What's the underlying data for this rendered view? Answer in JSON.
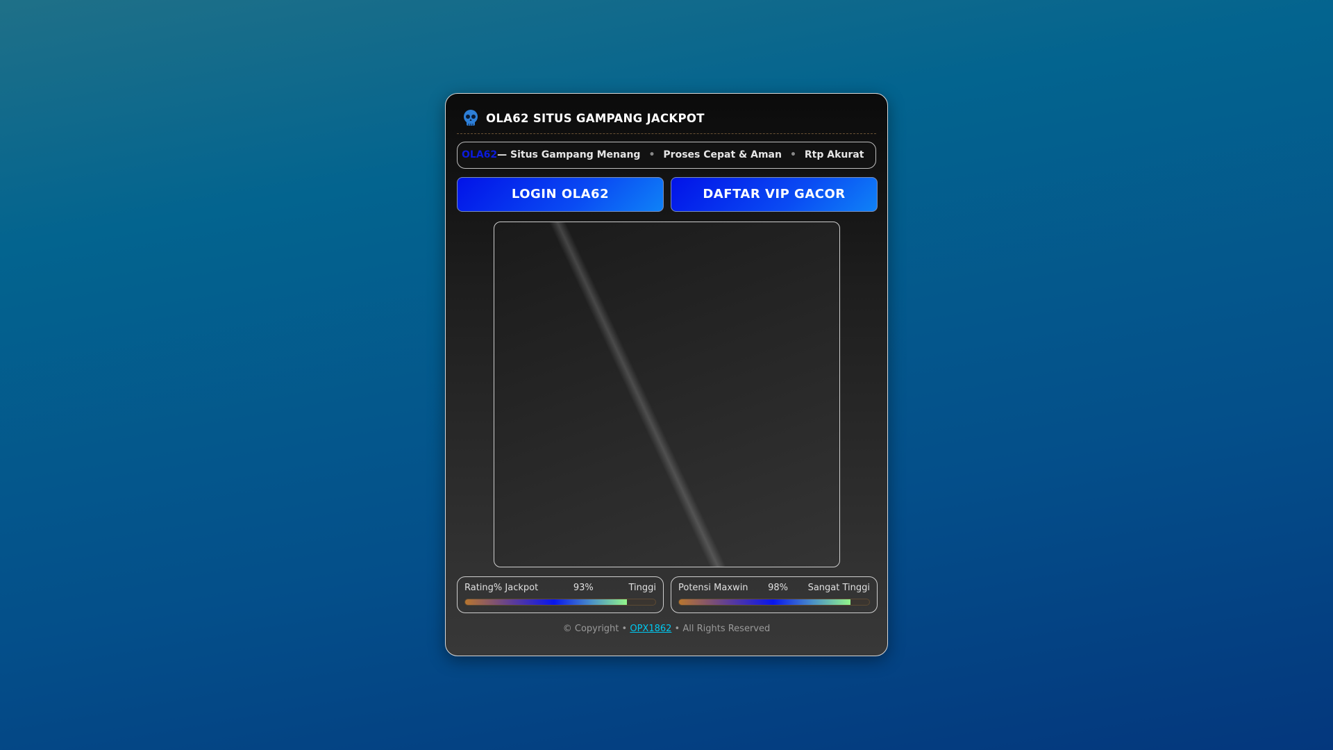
{
  "header": {
    "title": "OLA62 SITUS GAMPANG JACKPOT",
    "icon": "skull-icon"
  },
  "marquee": {
    "brand": "OLA62",
    "items": [
      "— Situs Gampang Menang",
      "Proses Cepat & Aman",
      "Rtp Akurat"
    ],
    "separator": "•"
  },
  "buttons": {
    "login": "LOGIN OLA62",
    "register": "DAFTAR VIP GACOR"
  },
  "stats": [
    {
      "label": "Rating% Jackpot",
      "value": "93%",
      "level": "Tinggi",
      "fill": 0.85
    },
    {
      "label": "Potensi Maxwin",
      "value": "98%",
      "level": "Sangat Tinggi",
      "fill": 0.9
    }
  ],
  "footer": {
    "prefix": "© Copyright •",
    "link": "OPX1862",
    "suffix": "• All Rights Reserved"
  },
  "colors": {
    "button": "#0a4bf3",
    "link": "#00c8f0"
  }
}
